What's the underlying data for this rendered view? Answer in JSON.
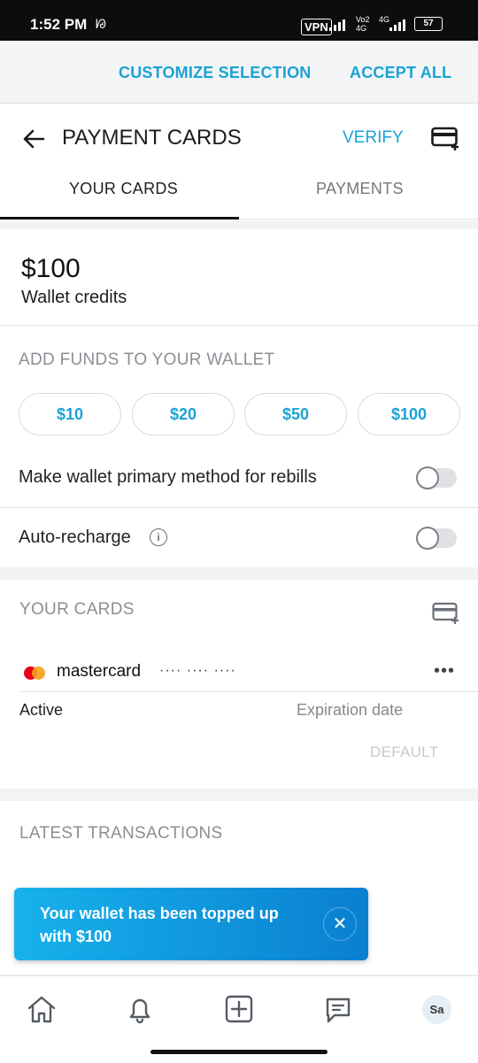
{
  "status_bar": {
    "time": "1:52 PM",
    "vpn": "VPN",
    "network_1": "Vo2 4G",
    "network_2": "4G",
    "battery": "57"
  },
  "consent": {
    "customize_label": "CUSTOMIZE SELECTION",
    "accept_label": "ACCEPT ALL"
  },
  "header": {
    "title": "PAYMENT CARDS",
    "verify_label": "VERIFY",
    "tabs": [
      {
        "label": "YOUR CARDS",
        "active": true
      },
      {
        "label": "PAYMENTS",
        "active": false
      }
    ]
  },
  "wallet": {
    "amount": "$100",
    "credits_label": "Wallet credits",
    "add_funds_heading": "ADD FUNDS TO YOUR WALLET",
    "amount_options": [
      "$10",
      "$20",
      "$50",
      "$100"
    ],
    "primary_label": "Make wallet primary method for rebills",
    "primary_enabled": false,
    "auto_recharge_label": "Auto-recharge",
    "auto_recharge_enabled": false
  },
  "cards": {
    "heading": "YOUR CARDS",
    "items": [
      {
        "brand": "mastercard",
        "number_masked": "···· ···· ···· ",
        "status": "Active",
        "expiration_label": "Expiration date",
        "default_label": "DEFAULT"
      }
    ]
  },
  "transactions": {
    "heading": "LATEST TRANSACTIONS"
  },
  "toast": {
    "message": "Your wallet has been topped up with $100"
  },
  "bottom_nav": {
    "avatar_initials": "Sa"
  },
  "colors": {
    "accent": "#1aa3d4",
    "toast_start": "#17b2ec",
    "toast_end": "#0a7fd0"
  }
}
